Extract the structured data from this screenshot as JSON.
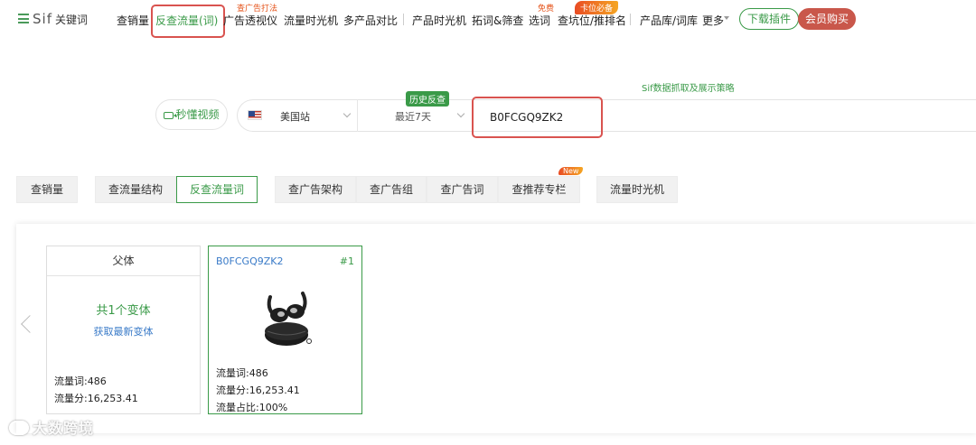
{
  "brand": {
    "name": "Sif",
    "keyword_label": "关键词"
  },
  "nav": {
    "items": [
      {
        "label": "查销量"
      },
      {
        "label": "反查流量(词)"
      },
      {
        "label": "广告透视仪"
      },
      {
        "label": "流量时光机"
      },
      {
        "label": "多产品对比"
      },
      {
        "label": "产品时光机"
      },
      {
        "label": "拓词&筛查"
      },
      {
        "label": "选词"
      },
      {
        "label": "查坑位/推排名"
      },
      {
        "label": "产品库/词库"
      },
      {
        "label": "更多"
      }
    ],
    "sup_ad_strategy": "查广告打法",
    "sup_free": "免费",
    "ribbon_must": "卡位必备",
    "download_label": "下载插件",
    "vip_label": "会员购买"
  },
  "search": {
    "strategy_link": "Sif数据抓取及展示策略",
    "video_label": "秒懂视频",
    "site_label": "美国站",
    "range_label": "最近7天",
    "history_badge": "历史反查",
    "asin_value": "B0FCGQ9ZK2"
  },
  "tabs": [
    {
      "label": "查销量"
    },
    {
      "label": "查流量结构"
    },
    {
      "label": "反查流量词"
    },
    {
      "label": "查广告架构"
    },
    {
      "label": "查广告组"
    },
    {
      "label": "查广告词"
    },
    {
      "label": "查推荐专栏"
    },
    {
      "label": "流量时光机"
    }
  ],
  "new_badge": "New",
  "parent_card": {
    "title": "父体",
    "variants_text": "共1个变体",
    "refresh_link": "获取最新变体",
    "traffic_words": "流量词:486",
    "traffic_score": "流量分:16,253.41"
  },
  "child_card": {
    "asin": "B0FCGQ9ZK2",
    "rank": "#1",
    "traffic_words": "流量词:486",
    "traffic_score": "流量分:16,253.41",
    "traffic_share": "流量占比:100%"
  },
  "watermark": "大数跨境",
  "colors": {
    "accent": "#3a9a48",
    "highlight": "#d9534f",
    "link": "#3a7bc8"
  }
}
